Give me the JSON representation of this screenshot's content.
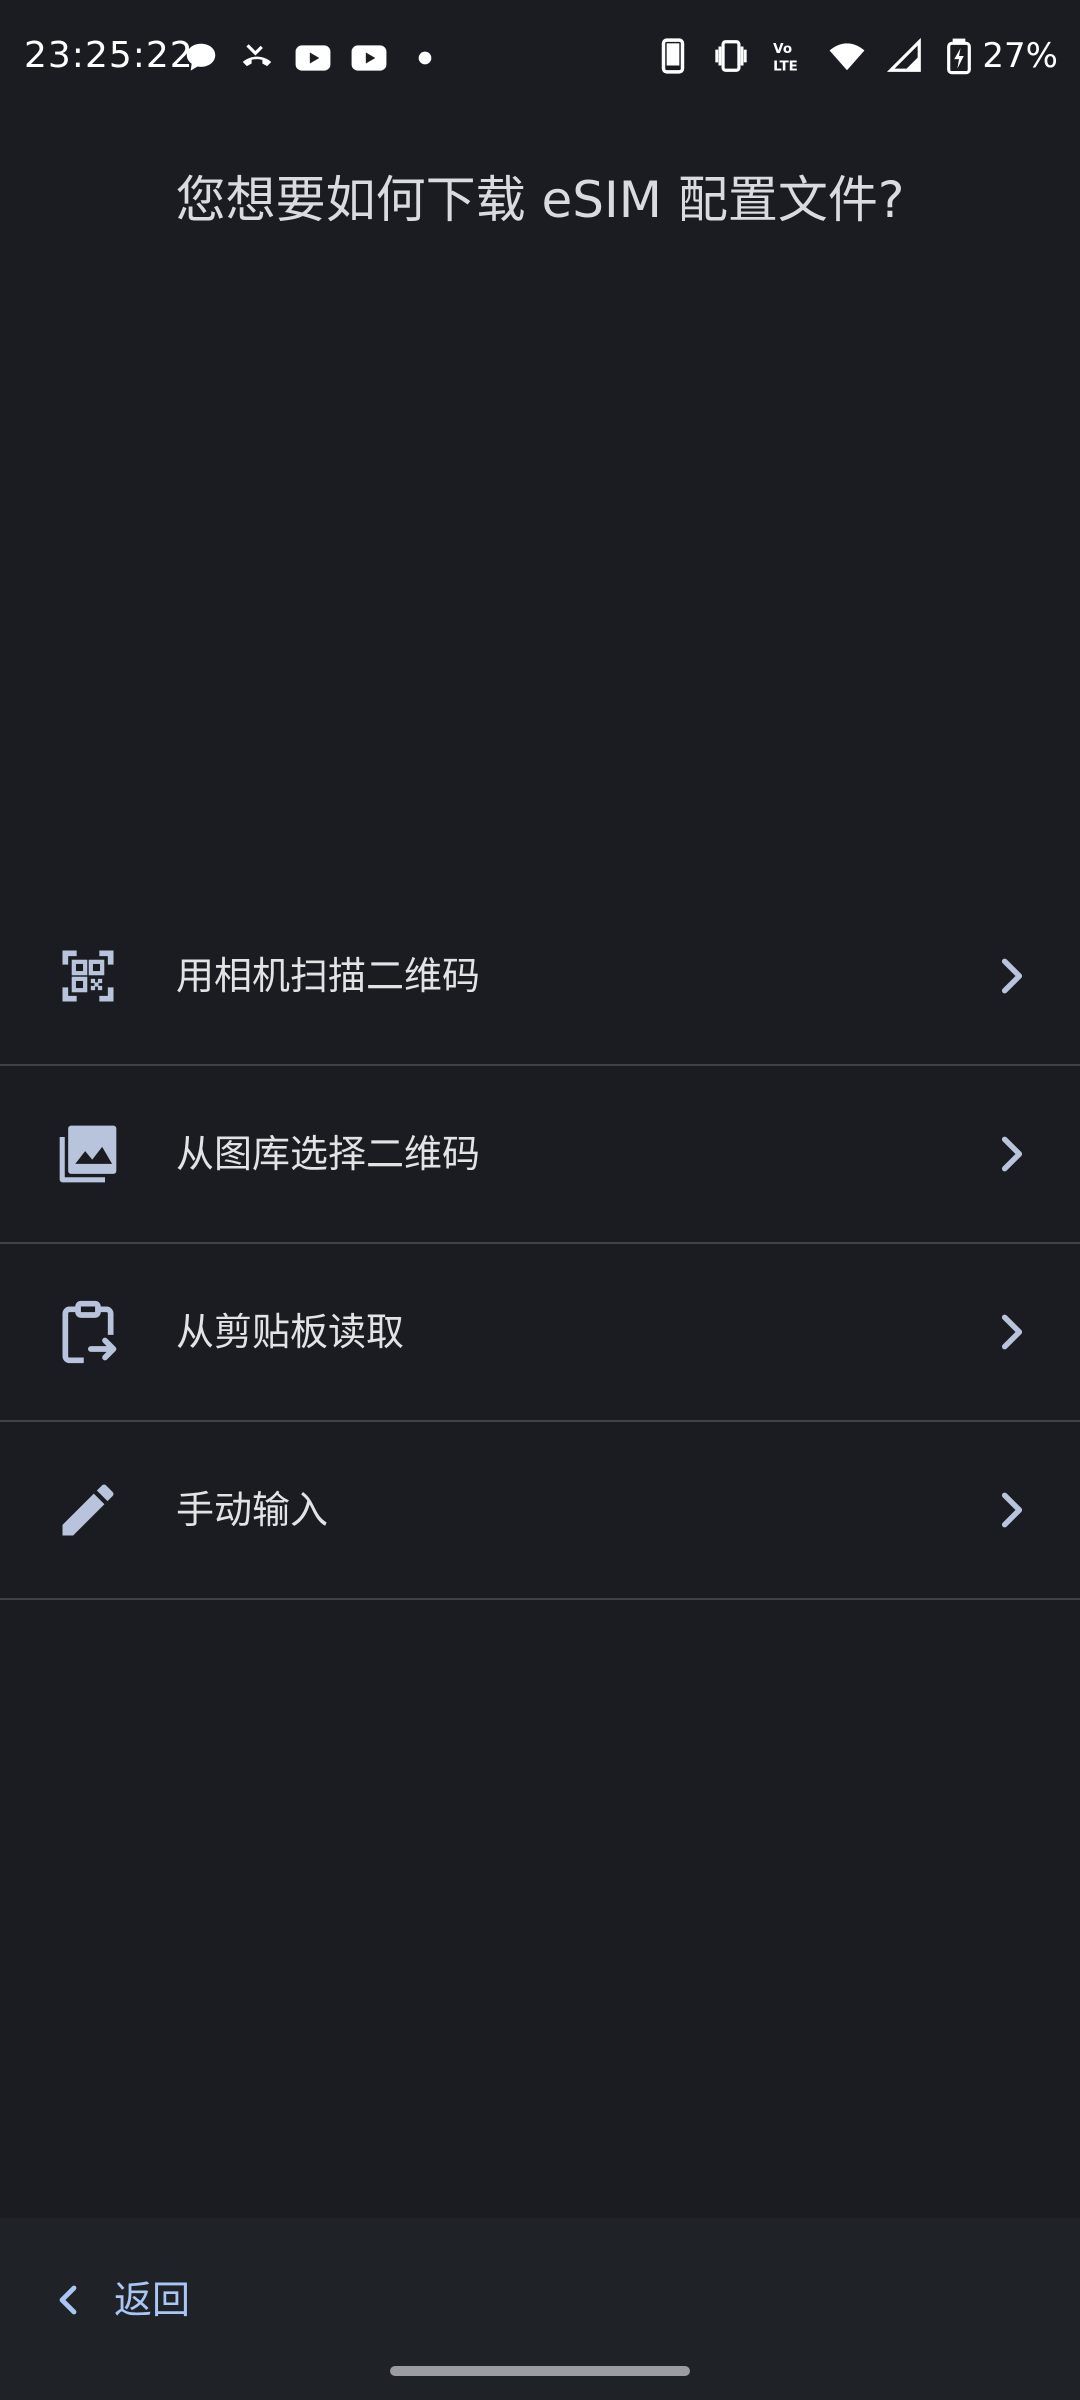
{
  "status_bar": {
    "time": "23:25:22",
    "battery": "27%",
    "left_icons": [
      "chat-bubble-icon",
      "missed-call-icon",
      "youtube-icon",
      "youtube-icon",
      "dot-icon"
    ],
    "right_icons": [
      "phone-icon",
      "vibrate-icon",
      "volte-icon",
      "wifi-icon",
      "signal-icon",
      "battery-charging-icon"
    ],
    "volte_text": "Vo LTE"
  },
  "title": "您想要如何下载 eSIM 配置文件?",
  "options": [
    {
      "label": "用相机扫描二维码",
      "icon": "qr-code-scan-icon"
    },
    {
      "label": "从图库选择二维码",
      "icon": "photo-library-icon"
    },
    {
      "label": "从剪贴板读取",
      "icon": "clipboard-icon"
    },
    {
      "label": "手动输入",
      "icon": "pencil-icon"
    }
  ],
  "back_button": {
    "label": "返回"
  },
  "colors": {
    "background": "#1a1c21",
    "accent": "#a9c6f5",
    "icon": "#b8c4dc",
    "divider": "#3d4148"
  }
}
